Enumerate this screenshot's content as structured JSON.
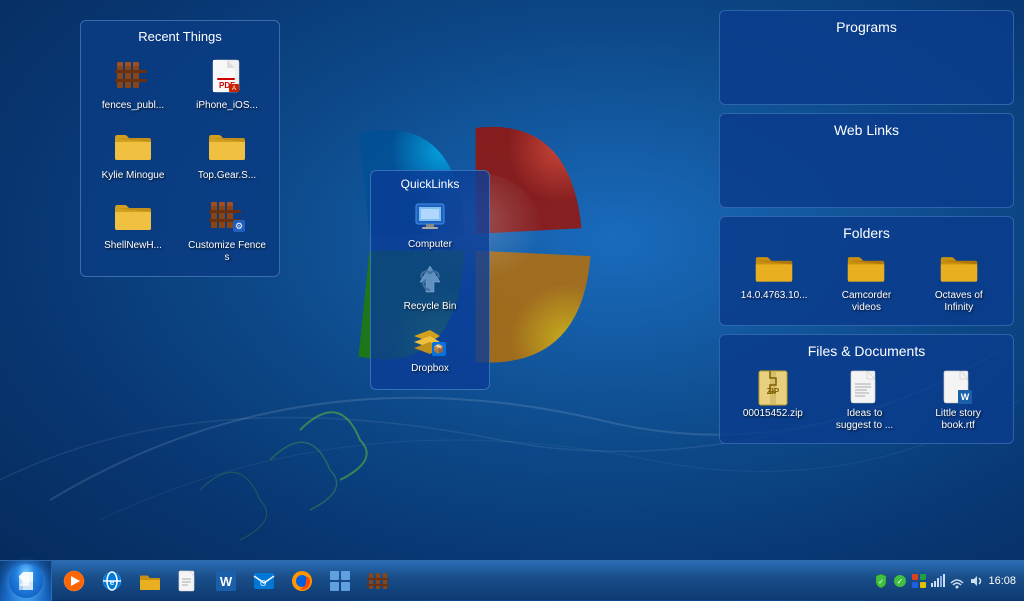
{
  "desktop": {
    "background": "windows7-blue"
  },
  "recent_panel": {
    "title": "Recent Things",
    "items": [
      {
        "label": "fences_publ...",
        "type": "fences"
      },
      {
        "label": "iPhone_iOS...",
        "type": "pdf"
      },
      {
        "label": "Kylie Minogue",
        "type": "folder"
      },
      {
        "label": "Top.Gear.S...",
        "type": "folder"
      },
      {
        "label": "ShellNewH...",
        "type": "folder"
      },
      {
        "label": "Customize Fences",
        "type": "fences"
      }
    ]
  },
  "quicklinks": {
    "title": "QuickLinks",
    "items": [
      {
        "label": "Computer",
        "type": "computer"
      },
      {
        "label": "Recycle Bin",
        "type": "recycle"
      },
      {
        "label": "Dropbox",
        "type": "dropbox"
      }
    ]
  },
  "programs_panel": {
    "title": "Programs",
    "items": []
  },
  "weblinks_panel": {
    "title": "Web Links",
    "items": []
  },
  "folders_panel": {
    "title": "Folders",
    "items": [
      {
        "label": "14.0.4763.10...",
        "type": "folder"
      },
      {
        "label": "Camcorder videos",
        "type": "folder"
      },
      {
        "label": "Octaves of Infinity",
        "type": "folder"
      }
    ]
  },
  "files_panel": {
    "title": "Files & Documents",
    "items": [
      {
        "label": "00015452.zip",
        "type": "zip"
      },
      {
        "label": "Ideas to suggest to ...",
        "type": "txt"
      },
      {
        "label": "Little story book.rtf",
        "type": "rtf"
      }
    ]
  },
  "taskbar": {
    "time": "16:08",
    "start_label": "Start",
    "icons": [
      {
        "name": "windows-media-player",
        "symbol": "▶"
      },
      {
        "name": "internet-explorer",
        "symbol": "e"
      },
      {
        "name": "windows-explorer",
        "symbol": "📁"
      },
      {
        "name": "word-pad",
        "symbol": "📄"
      },
      {
        "name": "word",
        "symbol": "W"
      },
      {
        "name": "outlook",
        "symbol": "📧"
      },
      {
        "name": "firefox",
        "symbol": "🦊"
      },
      {
        "name": "desktop-gadgets",
        "symbol": "⊞"
      },
      {
        "name": "fences",
        "symbol": "⠿"
      }
    ],
    "tray": [
      "🔒",
      "🔈",
      "📶",
      "🖥"
    ]
  }
}
